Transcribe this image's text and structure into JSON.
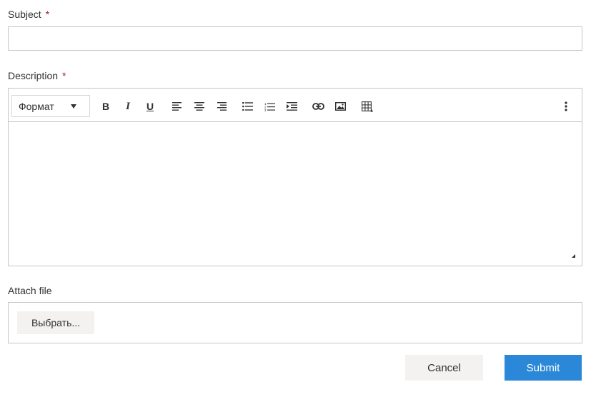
{
  "subject": {
    "label": "Subject",
    "required_mark": "*",
    "value": "",
    "placeholder": ""
  },
  "description": {
    "label": "Description",
    "required_mark": "*",
    "toolbar": {
      "format_label": "Формат",
      "bold_label": "B",
      "italic_label": "I",
      "underline_label": "U"
    },
    "content": ""
  },
  "attach": {
    "label": "Attach file",
    "choose_label": "Выбрать..."
  },
  "actions": {
    "cancel_label": "Cancel",
    "submit_label": "Submit"
  },
  "colors": {
    "accent": "#2b88d8",
    "required": "#a4262c",
    "border": "#c8c6c4",
    "neutral_button": "#f3f2f1"
  }
}
